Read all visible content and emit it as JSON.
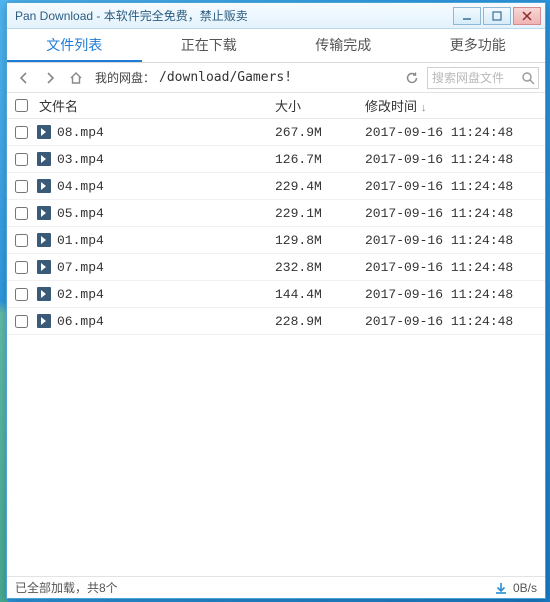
{
  "window": {
    "title": "Pan Download - 本软件完全免费，禁止贩卖"
  },
  "tabs": [
    {
      "id": "filelist",
      "label": "文件列表",
      "active": true
    },
    {
      "id": "downloading",
      "label": "正在下载",
      "active": false
    },
    {
      "id": "done",
      "label": "传输完成",
      "active": false
    },
    {
      "id": "more",
      "label": "更多功能",
      "active": false
    }
  ],
  "toolbar": {
    "path_label": "我的网盘：",
    "path_value": "/download/Gamers!",
    "search_placeholder": "搜索网盘文件"
  },
  "columns": {
    "name": "文件名",
    "size": "大小",
    "mtime": "修改时间"
  },
  "files": [
    {
      "name": "08.mp4",
      "size": "267.9M",
      "mtime": "2017-09-16 11:24:48"
    },
    {
      "name": "03.mp4",
      "size": "126.7M",
      "mtime": "2017-09-16 11:24:48"
    },
    {
      "name": "04.mp4",
      "size": "229.4M",
      "mtime": "2017-09-16 11:24:48"
    },
    {
      "name": "05.mp4",
      "size": "229.1M",
      "mtime": "2017-09-16 11:24:48"
    },
    {
      "name": "01.mp4",
      "size": "129.8M",
      "mtime": "2017-09-16 11:24:48"
    },
    {
      "name": "07.mp4",
      "size": "232.8M",
      "mtime": "2017-09-16 11:24:48"
    },
    {
      "name": "02.mp4",
      "size": "144.4M",
      "mtime": "2017-09-16 11:24:48"
    },
    {
      "name": "06.mp4",
      "size": "228.9M",
      "mtime": "2017-09-16 11:24:48"
    }
  ],
  "status": {
    "loaded_text": "已全部加载，共8个",
    "speed": "0B/s"
  }
}
